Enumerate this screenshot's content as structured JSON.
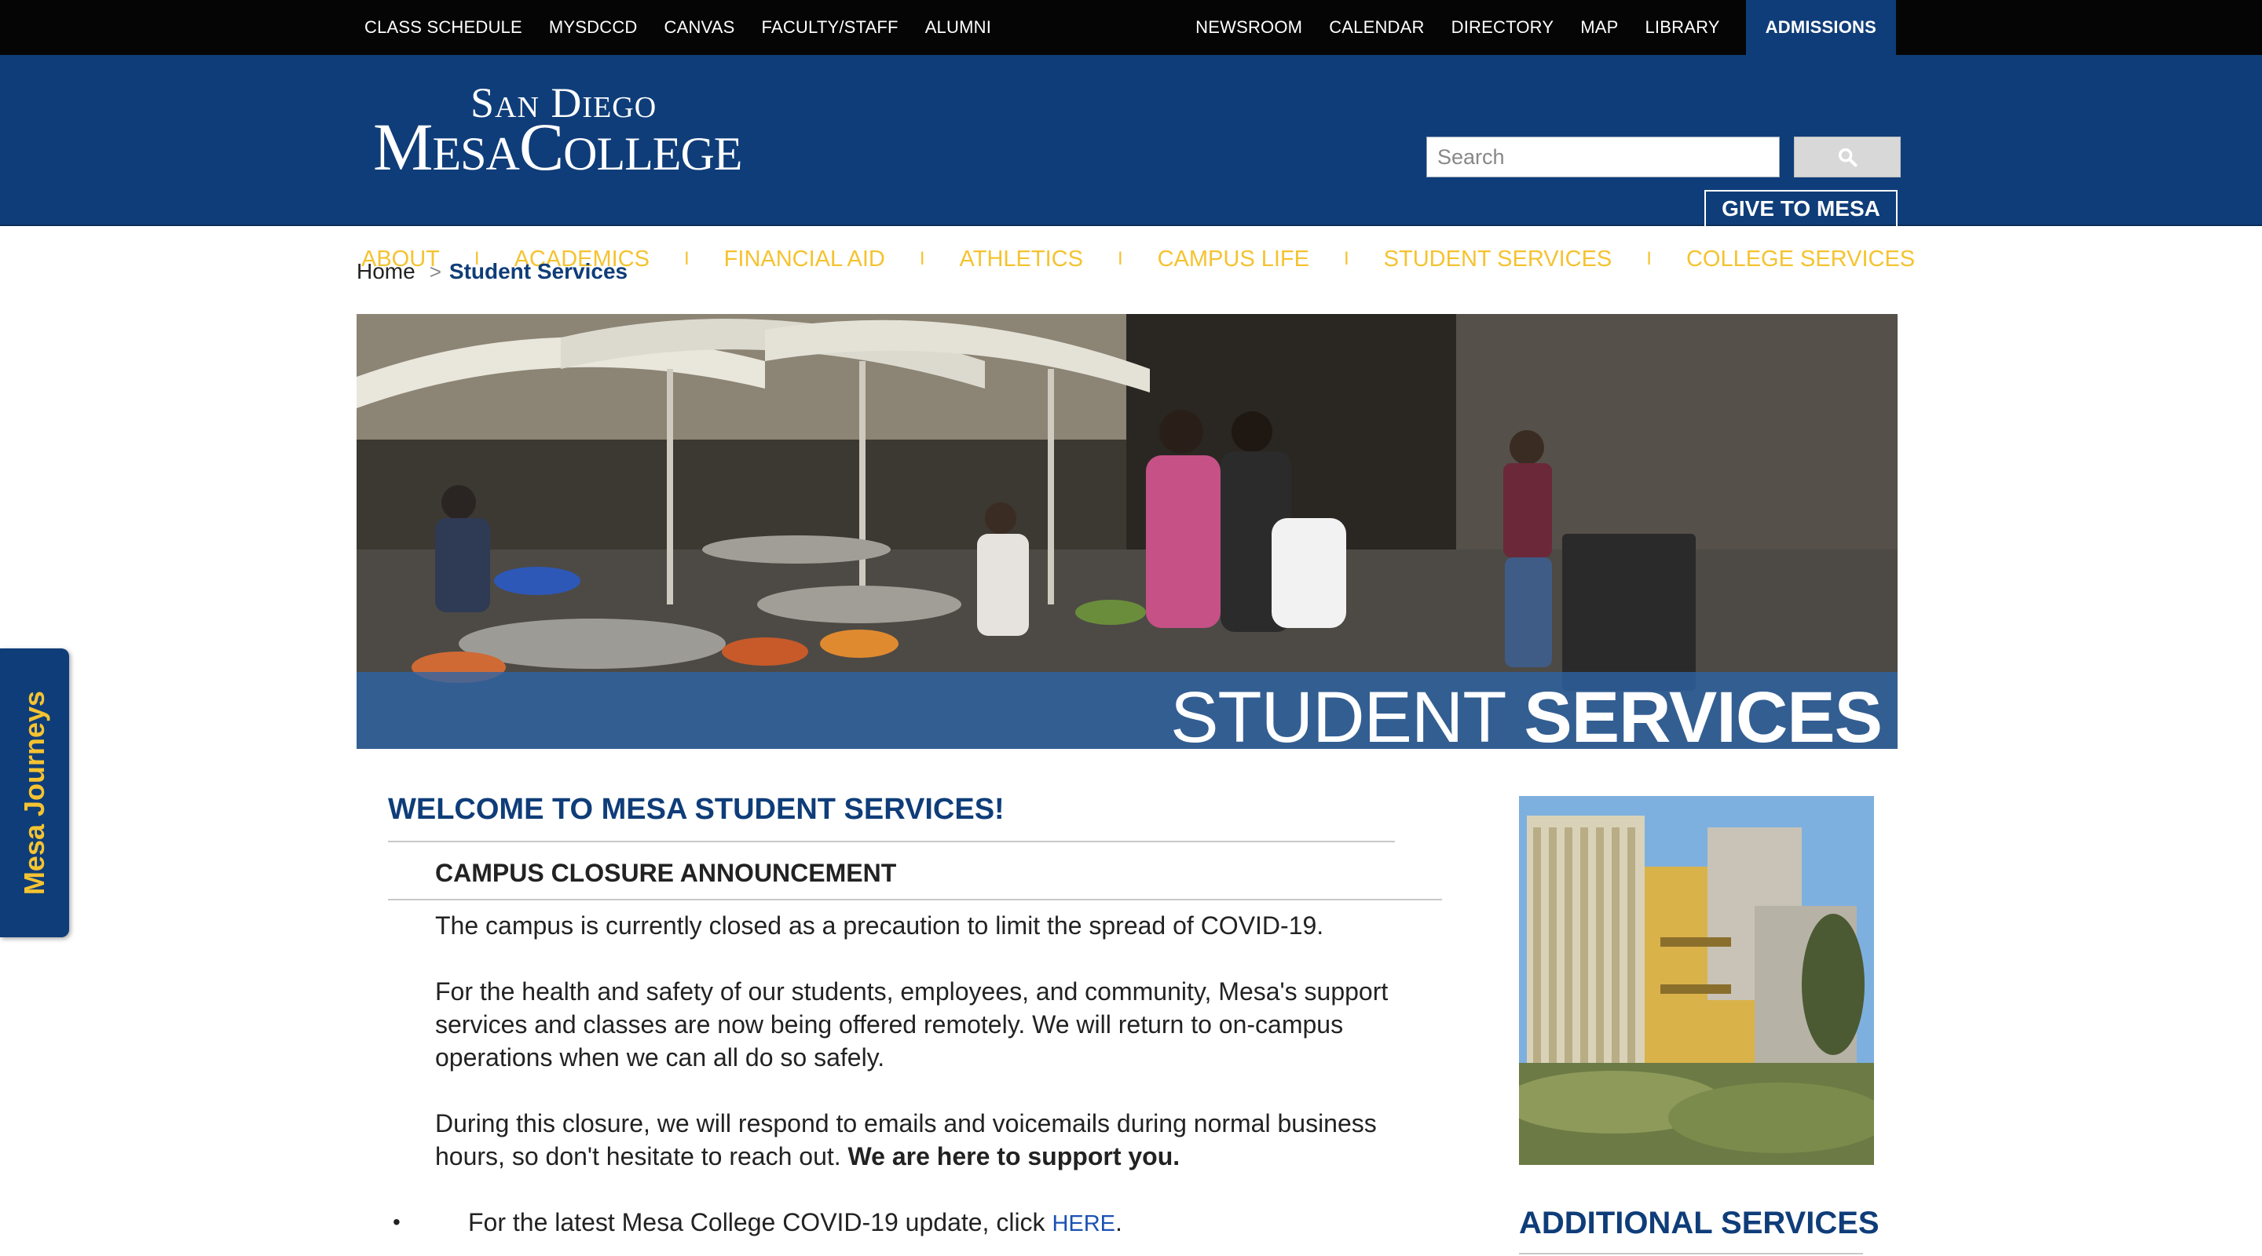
{
  "utility_nav": {
    "left": [
      "CLASS SCHEDULE",
      "MYSDCCD",
      "CANVAS",
      "FACULTY/STAFF",
      "ALUMNI"
    ],
    "right": [
      "NEWSROOM",
      "CALENDAR",
      "DIRECTORY",
      "MAP",
      "LIBRARY"
    ],
    "admissions": "ADMISSIONS"
  },
  "logo": {
    "line1": "San Diego",
    "line2": "MesaCollege"
  },
  "search": {
    "placeholder": "Search",
    "icon": "search-icon"
  },
  "give_label": "GIVE TO MESA",
  "main_nav": [
    "ABOUT",
    "ACADEMICS",
    "FINANCIAL AID",
    "ATHLETICS",
    "CAMPUS LIFE",
    "STUDENT SERVICES",
    "COLLEGE SERVICES"
  ],
  "nav_separator": "I",
  "breadcrumb": {
    "home": "Home",
    "separator": ">",
    "current": "Student Services"
  },
  "hero": {
    "title_light": "STUDENT ",
    "title_bold": "SERVICES"
  },
  "side_tab": "Mesa Journeys",
  "main": {
    "welcome": "WELCOME TO MESA STUDENT SERVICES!",
    "closure_heading": "CAMPUS CLOSURE ANNOUNCEMENT",
    "p1": "The campus is currently closed as a precaution to limit the spread of COVID-19.",
    "p2": "For the health and safety of our students, employees, and community, Mesa's support services and classes are now being offered remotely. We will return to on-campus operations when we can all do so safely.",
    "p3_a": "During this closure, we will respond to emails and voicemails during normal business hours, so don't hesitate to reach out. ",
    "p3_bold": "We are here to support you.",
    "bullet_dot": "•",
    "bullet_text": "For the latest Mesa College COVID-19 update, click ",
    "bullet_link": "HERE",
    "bullet_end": "."
  },
  "sidebar": {
    "additional_heading": "ADDITIONAL SERVICES"
  },
  "colors": {
    "navy": "#0f3d79",
    "gold": "#f5c331",
    "link": "#1a52b5",
    "black": "#050505"
  }
}
